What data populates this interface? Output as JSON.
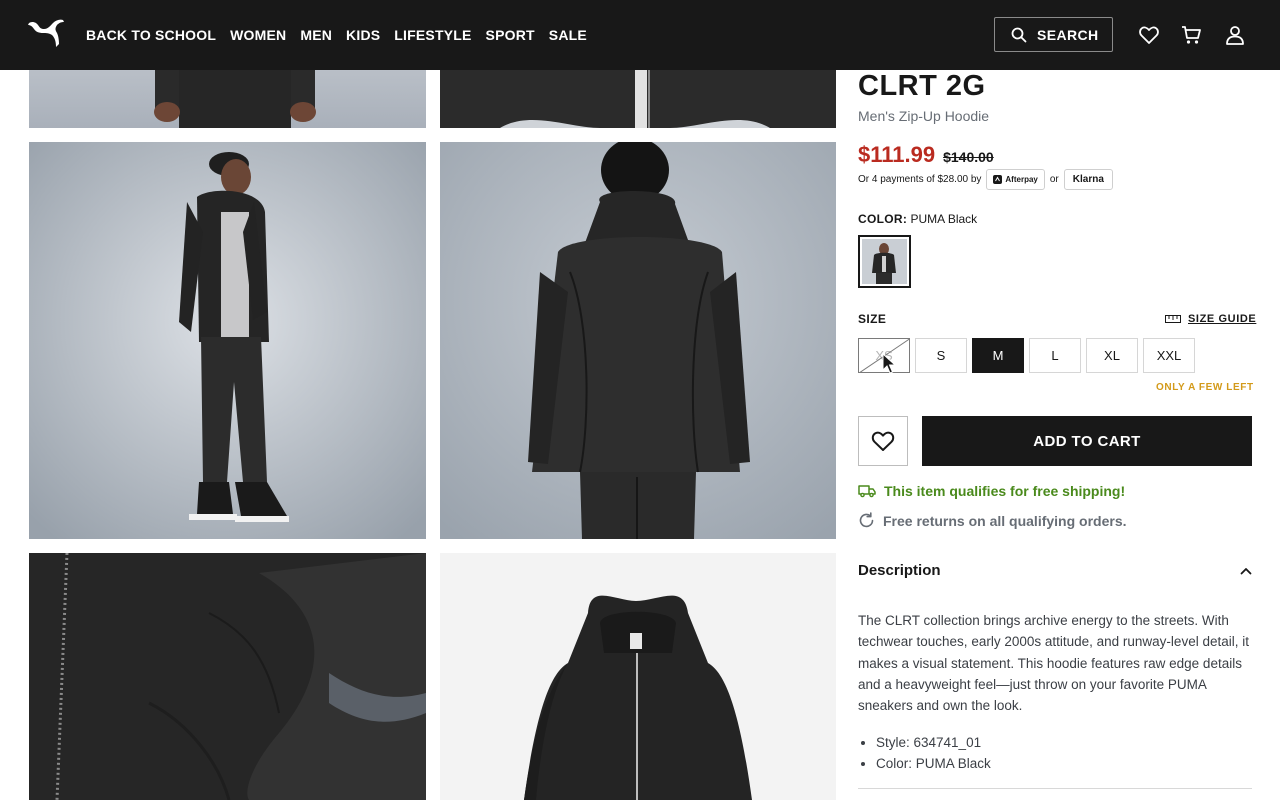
{
  "header": {
    "logo": "puma-logo",
    "nav": [
      "BACK TO SCHOOL",
      "WOMEN",
      "MEN",
      "KIDS",
      "LIFESTYLE",
      "SPORT",
      "SALE"
    ],
    "search_label": "SEARCH",
    "icons": [
      "search-icon",
      "heart-icon",
      "cart-icon",
      "account-icon"
    ],
    "background": "#181818"
  },
  "gallery": {
    "images": [
      "model-front-crop",
      "hoodie-zip-crop",
      "model-side-view",
      "model-back-view",
      "hoodie-detail-closeup",
      "hoodie-flat-front"
    ]
  },
  "product": {
    "title": "CLRT 2G",
    "subtitle": "Men's Zip-Up Hoodie",
    "price_sale": "$111.99",
    "price_original": "$140.00",
    "sale_color": "#ba2b20",
    "installments_text": "Or 4 payments of $28.00 by",
    "afterpay_label": "Afterpay",
    "or_text": "or",
    "klarna_label": "Klarna",
    "color_label": "COLOR:",
    "color_value": "PUMA Black",
    "size_label": "SIZE",
    "size_guide_label": "SIZE GUIDE",
    "sizes": [
      {
        "label": "XS",
        "state": "unavailable"
      },
      {
        "label": "S",
        "state": "available"
      },
      {
        "label": "M",
        "state": "selected"
      },
      {
        "label": "L",
        "state": "available"
      },
      {
        "label": "XL",
        "state": "available"
      },
      {
        "label": "XXL",
        "state": "available"
      }
    ],
    "stock_note": "ONLY A FEW LEFT",
    "stock_color": "#d39a1a",
    "add_to_cart_label": "ADD TO CART",
    "shipping_text": "This item qualifies for free shipping!",
    "shipping_color": "#4a8a1c",
    "returns_text": "Free returns on all qualifying orders."
  },
  "description": {
    "heading": "Description",
    "body": "The CLRT collection brings archive energy to the streets. With techwear touches, early 2000s attitude, and runway-level detail, it makes a visual statement. This hoodie features raw edge details and a heavyweight feel—just throw on your favorite PUMA sneakers and own the look.",
    "bullets": [
      "Style: 634741_01",
      "Color: PUMA Black"
    ]
  }
}
